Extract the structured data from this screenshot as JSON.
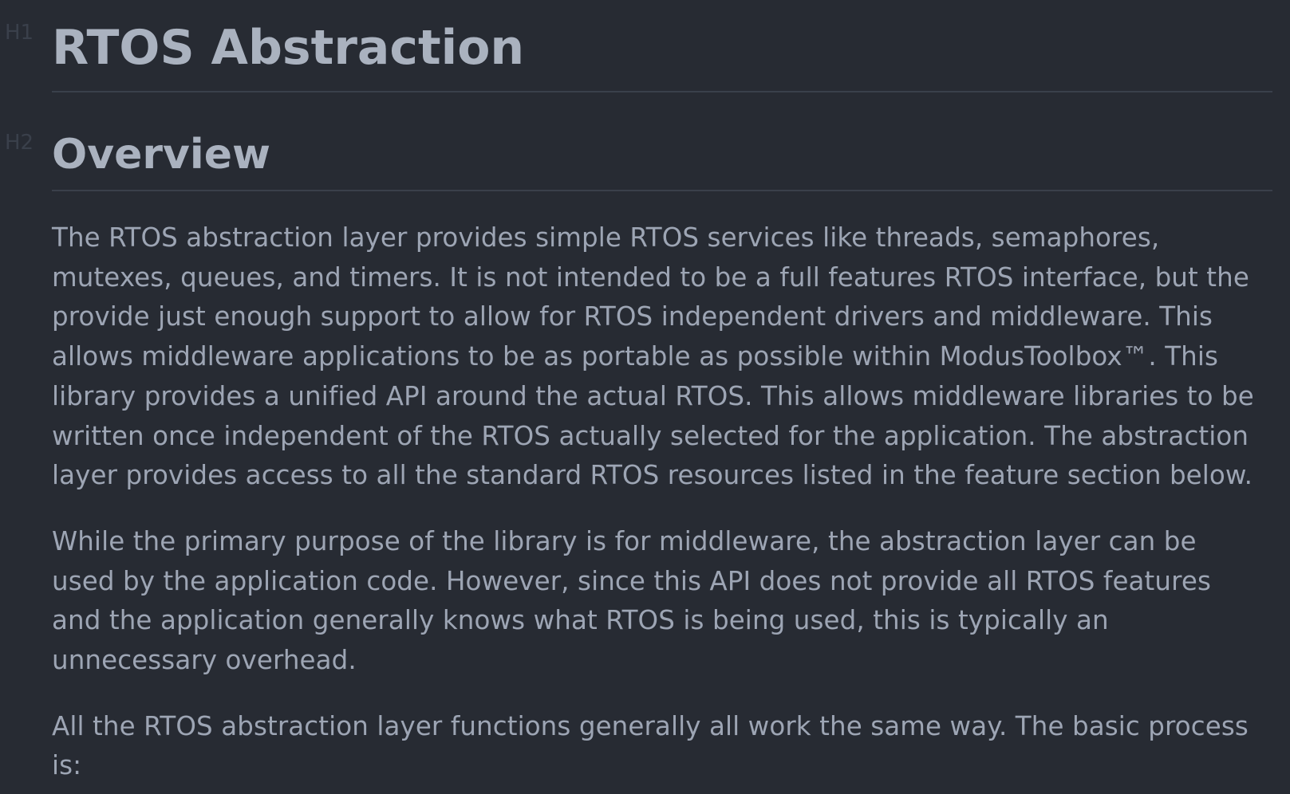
{
  "markers": {
    "h1": "H1",
    "h2": "H2"
  },
  "document": {
    "title": "RTOS Abstraction",
    "section_heading": "Overview",
    "paragraphs": [
      {
        "lines": [
          "The RTOS abstraction layer provides simple RTOS services like threads, semaphores,",
          "mutexes, queues, and timers. It is not intended to be a full features RTOS interface, but the",
          "provide just enough support to allow for RTOS independent drivers and middleware. This",
          "allows middleware applications to be as portable as possible within ModusToolbox™. This",
          "library provides a unified API around the actual RTOS. This allows middleware libraries to be",
          "written once independent of the RTOS actually selected for the application. The abstraction",
          "layer provides access to all the standard RTOS resources listed in the feature section below."
        ]
      },
      {
        "lines": [
          "While the primary purpose of the library is for middleware, the abstraction layer can be",
          "used by the application code. However, since this API does not provide all RTOS features",
          "and the application generally knows what RTOS is being used, this is typically an",
          "unnecessary overhead."
        ]
      },
      {
        "lines": [
          "All the RTOS abstraction layer functions generally all work the same way. The basic process",
          "is:"
        ]
      }
    ]
  },
  "colors": {
    "background": "#272b33",
    "heading": "#aab2bf",
    "body_text": "#9da5b4",
    "marker": "#3a404b",
    "rule": "#3a404b"
  }
}
